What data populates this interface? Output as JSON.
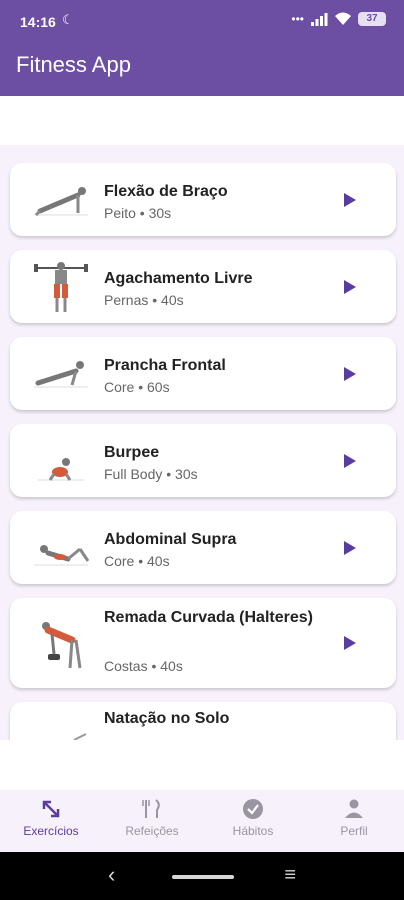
{
  "status_bar": {
    "time": "14:16",
    "battery": "37"
  },
  "app_bar": {
    "title": "Fitness App"
  },
  "exercises": [
    {
      "name": "Flexão de Braço",
      "meta": "Peito • 30s"
    },
    {
      "name": "Agachamento Livre",
      "meta": "Pernas • 40s"
    },
    {
      "name": "Prancha Frontal",
      "meta": "Core • 60s"
    },
    {
      "name": "Burpee",
      "meta": "Full Body • 30s"
    },
    {
      "name": "Abdominal Supra",
      "meta": "Core • 40s"
    },
    {
      "name": "Remada Curvada (Halteres)",
      "meta": "Costas • 40s"
    },
    {
      "name": "Natação no Solo",
      "meta": ""
    }
  ],
  "bottom_nav": [
    {
      "label": "Exercícios",
      "icon": "arrows-expand-icon",
      "active": true
    },
    {
      "label": "Refeições",
      "icon": "cutlery-icon"
    },
    {
      "label": "Hábitos",
      "icon": "check-circle-icon"
    },
    {
      "label": "Perfil",
      "icon": "person-icon"
    }
  ],
  "colors": {
    "primary": "#6c4ea3",
    "accent": "#5a3ca0",
    "background": "#f6f1fb"
  }
}
